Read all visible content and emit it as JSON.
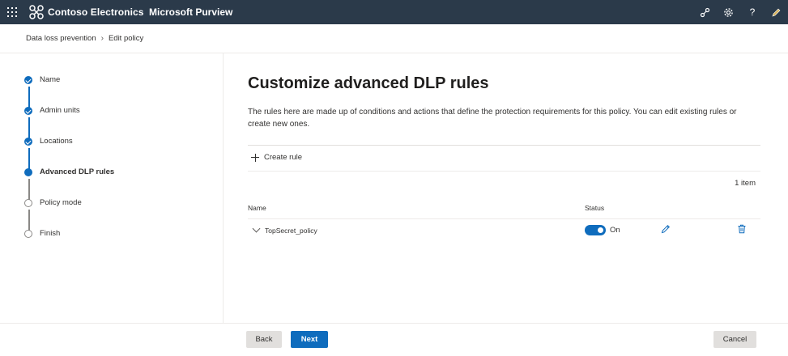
{
  "topbar": {
    "org_name": "Contoso Electronics",
    "app_name": "Microsoft Purview",
    "icons": [
      "waffle-icon",
      "share-icon",
      "settings-icon",
      "help-icon",
      "feedback-icon"
    ],
    "help_glyph": "?"
  },
  "breadcrumb": {
    "items": [
      "Data loss prevention",
      "Edit policy"
    ],
    "separator": "›"
  },
  "steps": [
    {
      "label": "Name",
      "state": "done"
    },
    {
      "label": "Admin units",
      "state": "done"
    },
    {
      "label": "Locations",
      "state": "done"
    },
    {
      "label": "Advanced DLP rules",
      "state": "current"
    },
    {
      "label": "Policy mode",
      "state": "todo"
    },
    {
      "label": "Finish",
      "state": "todo"
    }
  ],
  "main": {
    "title": "Customize advanced DLP rules",
    "description": "The rules here are made up of conditions and actions that define the protection requirements for this policy. You can edit existing rules or create new ones.",
    "create_rule_label": "Create rule",
    "item_count": "1 item",
    "columns": {
      "name": "Name",
      "status": "Status"
    },
    "rows": [
      {
        "name": "TopSecret_policy",
        "status": "On",
        "enabled": true
      }
    ]
  },
  "footer": {
    "back_label": "Back",
    "next_label": "Next",
    "cancel_label": "Cancel"
  },
  "colors": {
    "topbar": "#2b3a4a",
    "accent": "#0f6cbd",
    "secondary_button": "#e1dfdd"
  }
}
